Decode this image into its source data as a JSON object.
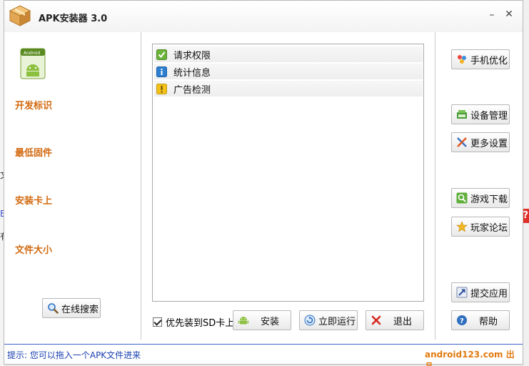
{
  "window": {
    "title": "APK安装器 3.0",
    "minimize_glyph": "–",
    "close_glyph": "✕"
  },
  "info": {
    "developer_label": "开发标识",
    "developer_value": "",
    "min_firmware_label": "最低固件",
    "min_firmware_value": "",
    "install_card_label": "安装卡上",
    "install_card_value": "",
    "file_size_label": "文件大小",
    "file_size_value": ""
  },
  "search_button": {
    "label": "在线搜索",
    "icon": "magnifier-icon"
  },
  "list": {
    "items": [
      {
        "label": "请求权限",
        "icon": "check-green-icon",
        "color": "#5aa52a"
      },
      {
        "label": "统计信息",
        "icon": "info-blue-icon",
        "color": "#2f7fd1"
      },
      {
        "label": "广告检测",
        "icon": "warning-yellow-icon",
        "color": "#f2c21b"
      }
    ]
  },
  "bottom": {
    "sd_label": "优先装到SD卡上",
    "sd_checked": true,
    "install_label": "安装",
    "run_label": "立即运行",
    "exit_label": "退出"
  },
  "right": {
    "optimize_label": "手机优化",
    "device_label": "设备管理",
    "settings_label": "更多设置",
    "games_label": "游戏下载",
    "forum_label": "玩家论坛",
    "submit_label": "提交应用",
    "help_label": "帮助"
  },
  "status": {
    "hint": "提示: 您可以拖入一个APK文件进来",
    "brand": "android123.com",
    "brand_suffix": "出品"
  },
  "colors": {
    "label_orange": "#d2690f",
    "status_blue": "#1a3fb0",
    "brand_orange": "#e07a10"
  }
}
